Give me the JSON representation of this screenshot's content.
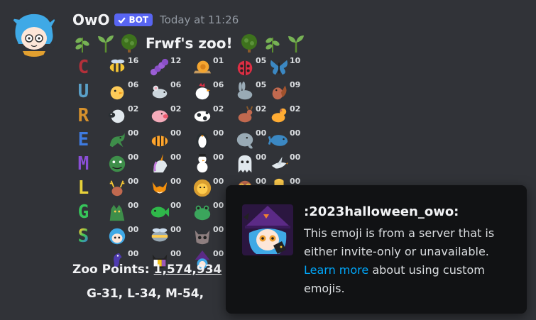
{
  "message": {
    "username": "OwO",
    "bot_label": "BOT",
    "timestamp": "Today at 11:26",
    "title": "Frwf's zoo!",
    "title_left_icons": [
      "herb-icon",
      "seedling-icon",
      "tree-icon"
    ],
    "title_right_icons": [
      "tree-icon",
      "herb-icon",
      "seedling-icon"
    ],
    "rows": [
      {
        "letter": "C",
        "letter_color": "#b3303a",
        "animals": [
          {
            "icon": "bee-icon",
            "count": "16"
          },
          {
            "icon": "caterpillar-icon",
            "count": "12"
          },
          {
            "icon": "snail-icon",
            "count": "01"
          },
          {
            "icon": "ladybug-icon",
            "count": "05"
          },
          {
            "icon": "butterfly-icon",
            "count": "10"
          }
        ]
      },
      {
        "letter": "U",
        "letter_color": "#5aa0c8",
        "animals": [
          {
            "icon": "chick-icon",
            "count": "06"
          },
          {
            "icon": "mouse-icon",
            "count": "06"
          },
          {
            "icon": "rooster-icon",
            "count": "06"
          },
          {
            "icon": "rabbit-icon",
            "count": "05"
          },
          {
            "icon": "chipmunk-icon",
            "count": "09"
          }
        ]
      },
      {
        "letter": "R",
        "letter_color": "#d6912c",
        "animals": [
          {
            "icon": "sheep-icon",
            "count": "02"
          },
          {
            "icon": "pig-icon",
            "count": "02"
          },
          {
            "icon": "cow-icon",
            "count": "02"
          },
          {
            "icon": "deer-icon",
            "count": "02"
          },
          {
            "icon": "dog-icon",
            "count": "02"
          }
        ]
      },
      {
        "letter": "E",
        "letter_color": "#3e7be0",
        "animals": [
          {
            "icon": "dragon-icon",
            "count": "00"
          },
          {
            "icon": "tiger-icon",
            "count": "00"
          },
          {
            "icon": "penguin-icon",
            "count": "00"
          },
          {
            "icon": "elephant-icon",
            "count": "00"
          },
          {
            "icon": "whale-icon",
            "count": "00"
          }
        ]
      },
      {
        "letter": "M",
        "letter_color": "#8a4fd6",
        "animals": [
          {
            "icon": "dragon-face-icon",
            "count": "00"
          },
          {
            "icon": "unicorn-icon",
            "count": "00"
          },
          {
            "icon": "snowman-icon",
            "count": "00"
          },
          {
            "icon": "ghost-icon",
            "count": "00"
          },
          {
            "icon": "dove-icon",
            "count": "00"
          }
        ]
      },
      {
        "letter": "L",
        "letter_color": "#e8d23a",
        "animals": [
          {
            "icon": "reindeer-icon",
            "count": "00"
          },
          {
            "icon": "fox-icon",
            "count": "00"
          },
          {
            "icon": "lion-icon",
            "count": "00"
          },
          {
            "icon": "owl-icon",
            "count": "00"
          },
          {
            "icon": "squid-icon",
            "count": "00"
          }
        ]
      },
      {
        "letter": "G",
        "letter_color": "#37c45a",
        "animals": [
          {
            "icon": "kaiju-icon",
            "count": "00"
          },
          {
            "icon": "fish-icon",
            "count": "00"
          },
          {
            "icon": "frog-icon",
            "count": "00"
          },
          {
            "icon": "hidden-icon",
            "count": ""
          },
          {
            "icon": "hidden-icon",
            "count": ""
          }
        ]
      },
      {
        "letter": "S",
        "letter_color": "rainbow",
        "animals": [
          {
            "icon": "owo-girl-icon",
            "count": "00"
          },
          {
            "icon": "bee-mech-icon",
            "count": "00"
          },
          {
            "icon": "skull-cat-icon",
            "count": "00"
          },
          {
            "icon": "hidden-icon",
            "count": ""
          },
          {
            "icon": "hidden-icon",
            "count": ""
          }
        ]
      },
      {
        "letter": "",
        "letter_color": "",
        "animals": [
          {
            "icon": "seahorse-icon",
            "count": "00"
          },
          {
            "icon": "flag-cat-icon",
            "count": "00"
          },
          {
            "icon": "witch-owo-icon",
            "count": "00"
          },
          {
            "icon": "hidden-icon",
            "count": ""
          },
          {
            "icon": "hidden-icon",
            "count": ""
          }
        ]
      }
    ],
    "points_label": "Zoo Points:",
    "points_value": "1,574,934",
    "stats_line": "G-31, L-34, M-54, "
  },
  "emoji_popup": {
    "name": ":2023halloween_owo:",
    "description": "This emoji is from a server that is either invite-only or unavailable.",
    "link_text": "Learn more",
    "description_tail": " about using custom emojis."
  },
  "colors": {
    "background": "#313338",
    "blurple": "#5865f2",
    "link": "#00a8fc",
    "popup_background": "#111214"
  }
}
